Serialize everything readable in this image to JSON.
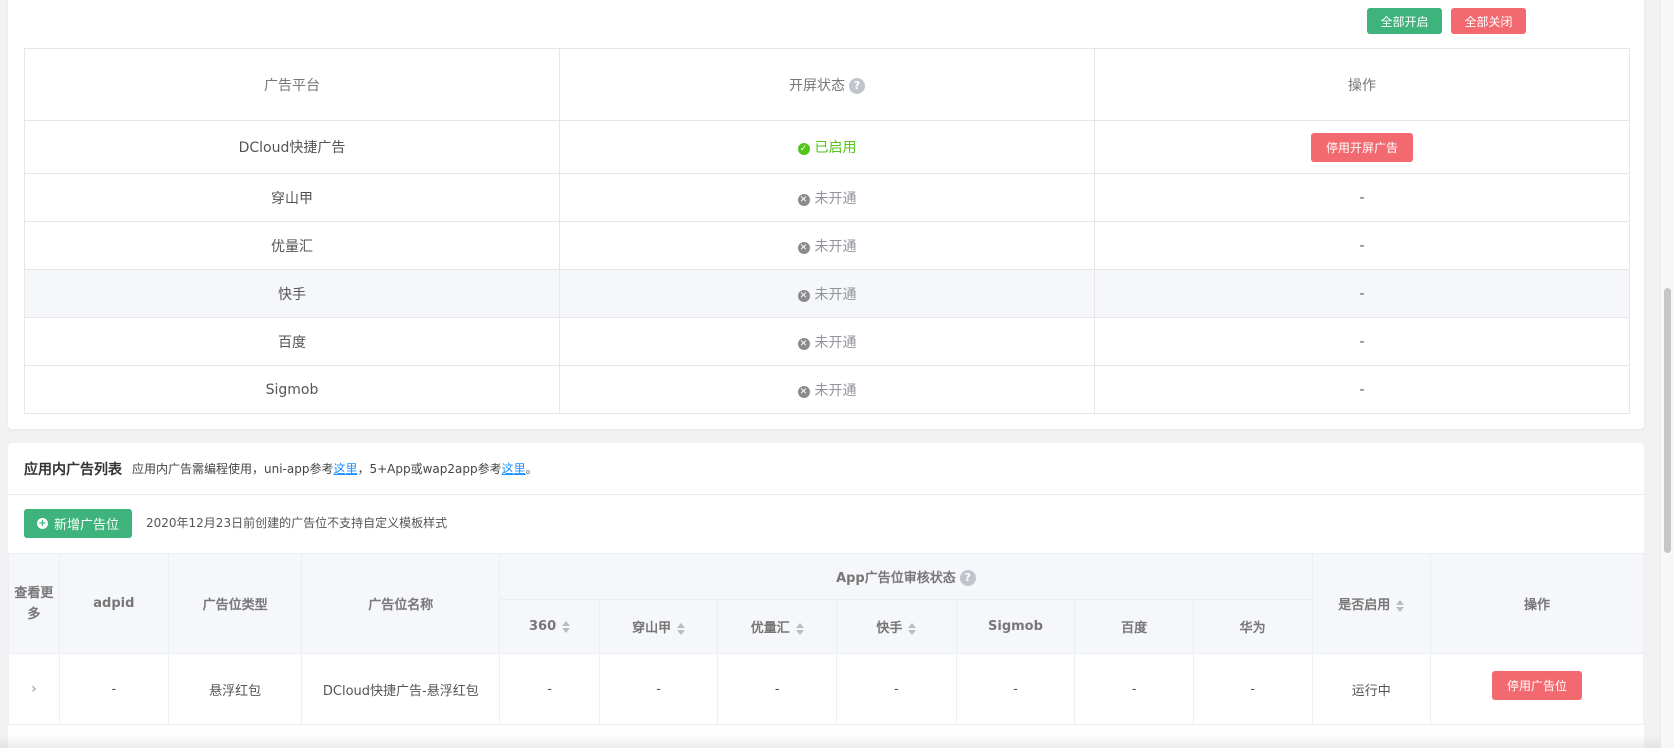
{
  "top_actions": {
    "enable_all": "全部开启",
    "disable_all": "全部关闭"
  },
  "splash_table": {
    "headers": {
      "platform": "广告平台",
      "status": "开屏状态",
      "help": "?",
      "action": "操作"
    },
    "rows": [
      {
        "platform": "DCloud快捷广告",
        "status": "已启用",
        "state": "on",
        "action": "停用开屏广告"
      },
      {
        "platform": "穿山甲",
        "status": "未开通",
        "state": "off",
        "action": "-"
      },
      {
        "platform": "优量汇",
        "status": "未开通",
        "state": "off",
        "action": "-"
      },
      {
        "platform": "快手",
        "status": "未开通",
        "state": "off",
        "action": "-"
      },
      {
        "platform": "百度",
        "status": "未开通",
        "state": "off",
        "action": "-"
      },
      {
        "platform": "Sigmob",
        "status": "未开通",
        "state": "off",
        "action": "-"
      }
    ]
  },
  "inapp": {
    "title": "应用内广告列表",
    "desc_prefix": "应用内广告需编程使用，uni-app参考",
    "link1": "这里",
    "desc_mid": "，5+App或wap2app参考",
    "link2": "这里",
    "desc_suffix": "。",
    "add_button": "新增广告位",
    "add_note": "2020年12月23日前创建的广告位不支持自定义模板样式",
    "headers": {
      "view_more": "查看更多",
      "adpid": "adpid",
      "type": "广告位类型",
      "name": "广告位名称",
      "review_group": "App广告位审核状态",
      "help": "?",
      "enabled": "是否启用",
      "action": "操作",
      "platforms": [
        "360",
        "穿山甲",
        "优量汇",
        "快手",
        "Sigmob",
        "百度",
        "华为"
      ]
    },
    "rows": [
      {
        "expand": "›",
        "adpid": "-",
        "type": "悬浮红包",
        "name": "DCloud快捷广告-悬浮红包",
        "p360": "-",
        "csj": "-",
        "ylh": "-",
        "ks": "-",
        "sigmob": "-",
        "baidu": "-",
        "huawei": "-",
        "enabled": "运行中",
        "action": "停用广告位"
      }
    ]
  },
  "colors": {
    "green": "#3eb37b",
    "red": "#f26a6f",
    "success": "#52c41a",
    "link": "#1890ff"
  }
}
